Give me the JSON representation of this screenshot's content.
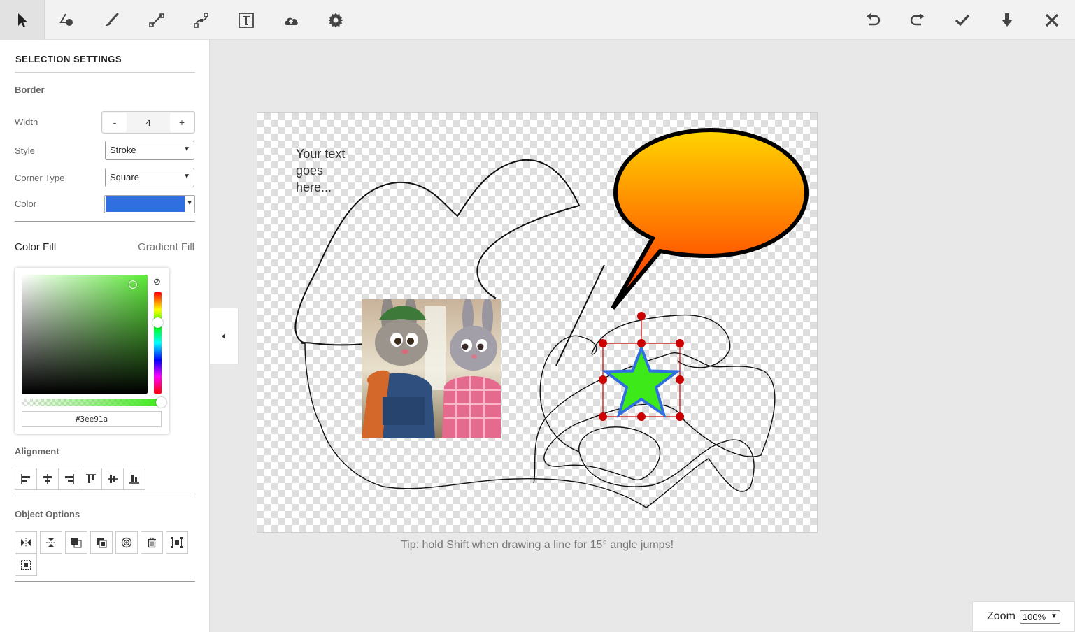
{
  "toolbar": {
    "left_tools": [
      {
        "name": "select-tool",
        "icon": "cursor-arrow-icon",
        "active": true
      },
      {
        "name": "shape-tool",
        "icon": "shapes-icon"
      },
      {
        "name": "brush-tool",
        "icon": "brush-icon"
      },
      {
        "name": "line-tool",
        "icon": "line-icon"
      },
      {
        "name": "path-tool",
        "icon": "bezier-path-icon"
      },
      {
        "name": "text-tool",
        "icon": "text-icon"
      },
      {
        "name": "upload-tool",
        "icon": "cloud-upload-icon"
      },
      {
        "name": "settings-tool",
        "icon": "gear-icon"
      }
    ],
    "right_tools": [
      {
        "name": "undo-button",
        "icon": "undo-icon"
      },
      {
        "name": "redo-button",
        "icon": "redo-icon"
      },
      {
        "name": "apply-button",
        "icon": "checkmark-icon"
      },
      {
        "name": "download-button",
        "icon": "download-arrow-icon"
      },
      {
        "name": "close-button",
        "icon": "close-icon"
      }
    ]
  },
  "panel": {
    "title": "SELECTION SETTINGS",
    "border": {
      "heading": "Border",
      "width_label": "Width",
      "width_minus": "-",
      "width_value": "4",
      "width_plus": "+",
      "style_label": "Style",
      "style_value": "Stroke",
      "corner_label": "Corner Type",
      "corner_value": "Square",
      "color_label": "Color",
      "color_value": "#2f6fe0"
    },
    "fill_tabs": {
      "color_fill": "Color Fill",
      "gradient_fill": "Gradient Fill",
      "active": "color_fill"
    },
    "picker": {
      "hex": "#3ee91a",
      "hue_color": "#5eea3a"
    },
    "alignment_heading": "Alignment",
    "alignment_buttons": [
      "align-left-icon",
      "align-center-horizontal-icon",
      "align-right-icon",
      "align-top-icon",
      "align-middle-vertical-icon",
      "align-bottom-icon"
    ],
    "object_options_heading": "Object Options",
    "object_buttons": [
      "flip-horizontal-icon",
      "flip-vertical-icon",
      "bring-forward-icon",
      "send-backward-icon",
      "duplicate-icon",
      "delete-icon",
      "fit-to-canvas-icon",
      "center-object-icon"
    ]
  },
  "canvas": {
    "placeholder_text": "Your text\ngoes\nhere...",
    "star_fill": "#3ee91a",
    "star_stroke": "#2f6fe0",
    "bubble_gradient_top": "#ffd400",
    "bubble_gradient_bottom": "#ff2a00",
    "selection_handle_color": "#cc0000"
  },
  "tip": "Tip: hold Shift when drawing a line for 15° angle jumps!",
  "zoom": {
    "label": "Zoom",
    "value": "100%"
  }
}
